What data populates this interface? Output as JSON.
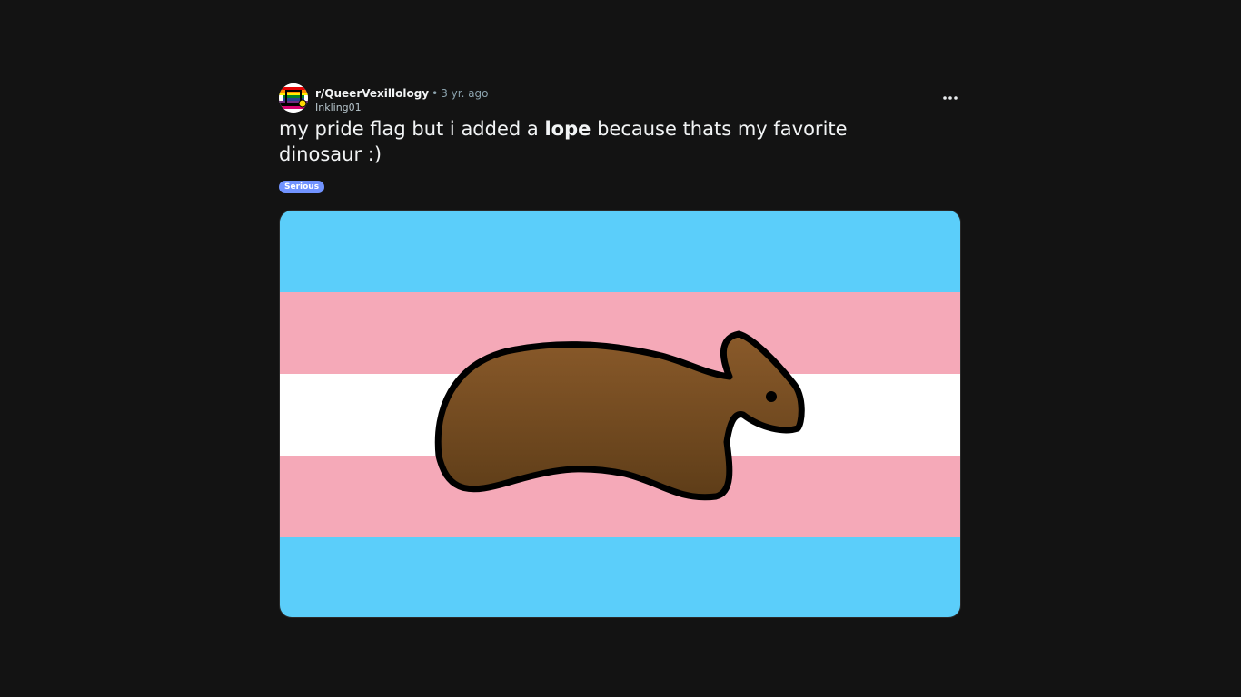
{
  "post": {
    "subreddit": "r/QueerVexillology",
    "separator": "•",
    "time": "3 yr. ago",
    "author": "Inkling01",
    "title_before": "my pride flag but i added a",
    "title_bold": "lope",
    "title_after": "because thats my favorite dinosaur :)",
    "flair": "Serious",
    "more_icon": "more-horizontal-icon"
  },
  "colors": {
    "background": "#131313",
    "flair": "#7193ff",
    "flag_blue": "#5bcefa",
    "flag_pink": "#f5a9b8",
    "flag_white": "#ffffff",
    "creature": "#7a4f22"
  }
}
